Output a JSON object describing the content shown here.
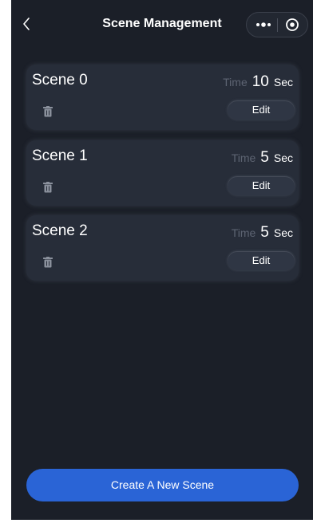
{
  "header": {
    "title": "Scene Management"
  },
  "scenes": [
    {
      "name": "Scene 0",
      "time_label": "Time",
      "time_value": "10",
      "time_unit": "Sec",
      "edit_label": "Edit"
    },
    {
      "name": "Scene 1",
      "time_label": "Time",
      "time_value": "5",
      "time_unit": "Sec",
      "edit_label": "Edit"
    },
    {
      "name": "Scene 2",
      "time_label": "Time",
      "time_value": "5",
      "time_unit": "Sec",
      "edit_label": "Edit"
    }
  ],
  "footer": {
    "create_label": "Create A New Scene"
  },
  "icons": {
    "back": "chevron-left-icon",
    "more": "more-dots-icon",
    "close": "target-circle-icon",
    "delete": "trash-icon"
  },
  "colors": {
    "background": "#1b1f28",
    "card": "#272d39",
    "accent": "#2a64d6"
  }
}
